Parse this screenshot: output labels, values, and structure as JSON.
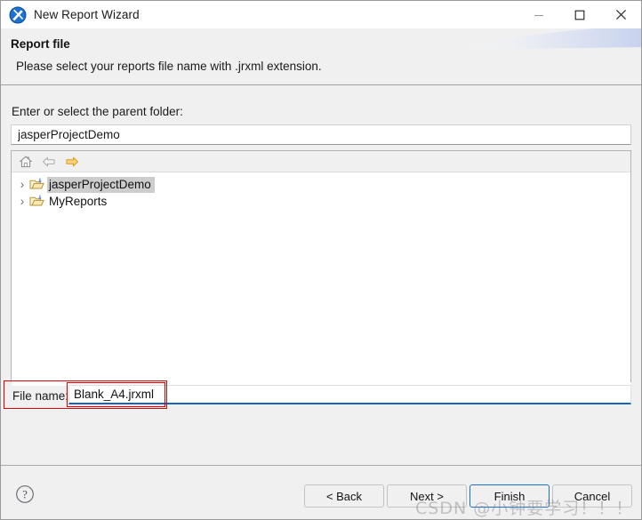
{
  "window": {
    "title": "New Report Wizard",
    "icon": "jasperreports-icon",
    "controls": {
      "minimize": "minimize-icon",
      "maximize": "maximize-icon",
      "close": "close-icon"
    }
  },
  "header": {
    "title": "Report file",
    "description": "Please select your reports file name with .jrxml extension."
  },
  "main": {
    "parent_folder_label": "Enter or select the parent folder:",
    "parent_folder_value": "jasperProjectDemo",
    "parent_folder_placeholder": "",
    "tree_toolbar": [
      {
        "name": "home-icon",
        "title": "Home"
      },
      {
        "name": "back-arrow-icon",
        "title": "Back"
      },
      {
        "name": "forward-arrow-icon",
        "title": "Forward"
      }
    ],
    "tree_items": [
      {
        "label": "jasperProjectDemo",
        "selected": true,
        "expander": "›",
        "icon": "open-folder-icon"
      },
      {
        "label": "MyReports",
        "selected": false,
        "expander": "›",
        "icon": "open-folder-icon"
      }
    ],
    "file_name_label": "File name:",
    "file_name_value": "Blank_A4.jrxml",
    "file_name_placeholder": ""
  },
  "footer": {
    "help": "?",
    "buttons": [
      {
        "label": "< Back",
        "focused": false
      },
      {
        "label": "Next >",
        "focused": false
      },
      {
        "label": "Finish",
        "focused": true
      },
      {
        "label": "Cancel",
        "focused": false
      }
    ]
  },
  "watermark": "CSDN @小钟要学习！！！",
  "colors": {
    "accent": "#1565c0",
    "focus_border": "#1a73c8",
    "annotation": "#e00000",
    "panel_bg": "#f0f0f0",
    "selection": "#cdcdcd"
  }
}
